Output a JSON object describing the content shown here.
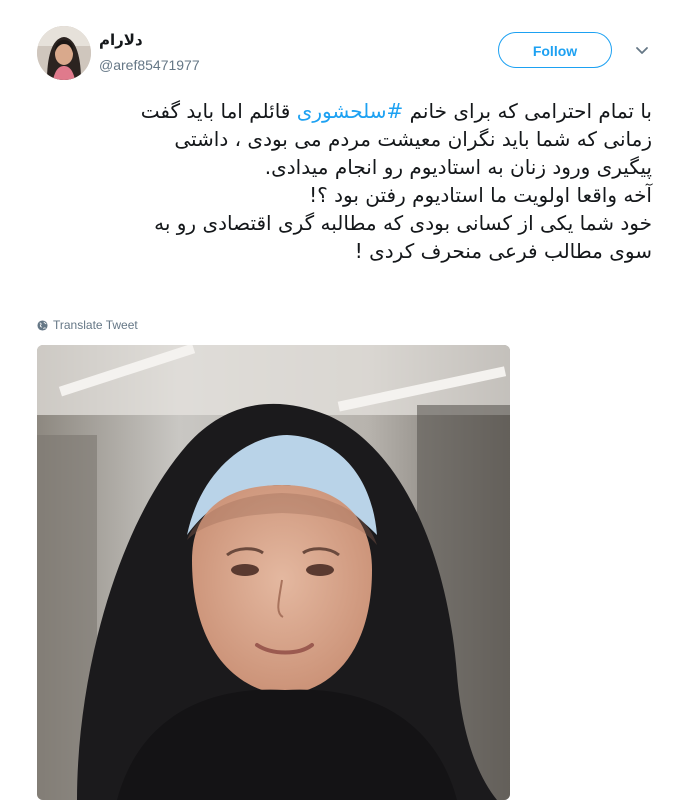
{
  "tweet": {
    "author": {
      "display_name": "دلارام",
      "handle": "@aref85471977",
      "avatar_icon": "user-avatar-photo"
    },
    "follow_label": "Follow",
    "caret_icon": "chevron-down-icon",
    "text_lines": [
      {
        "before": "با تمام احترامی که برای خانم ",
        "hashtag": "#سلحشوری",
        "after": " قائلم اما باید گفت"
      },
      {
        "text": "زمانی که شما باید نگران معیشت مردم می بودی ، داشتی"
      },
      {
        "text": "پیگیری ورود زنان به استادیوم رو انجام میدادی."
      },
      {
        "text": "آخه واقعا اولویت ما استادیوم رفتن بود ؟!"
      },
      {
        "text": "خود شما یکی از کسانی بودی که مطالبه گری اقتصادی رو به"
      },
      {
        "text": "سوی مطالب فرعی منحرف کردی !"
      }
    ],
    "translate_label": "Translate Tweet",
    "translate_icon": "globe-icon",
    "media": {
      "type": "photo",
      "subject": "woman-in-black-chador-portrait"
    },
    "colors": {
      "accent": "#1da1f2",
      "text": "#14171a",
      "secondary": "#657786"
    }
  }
}
